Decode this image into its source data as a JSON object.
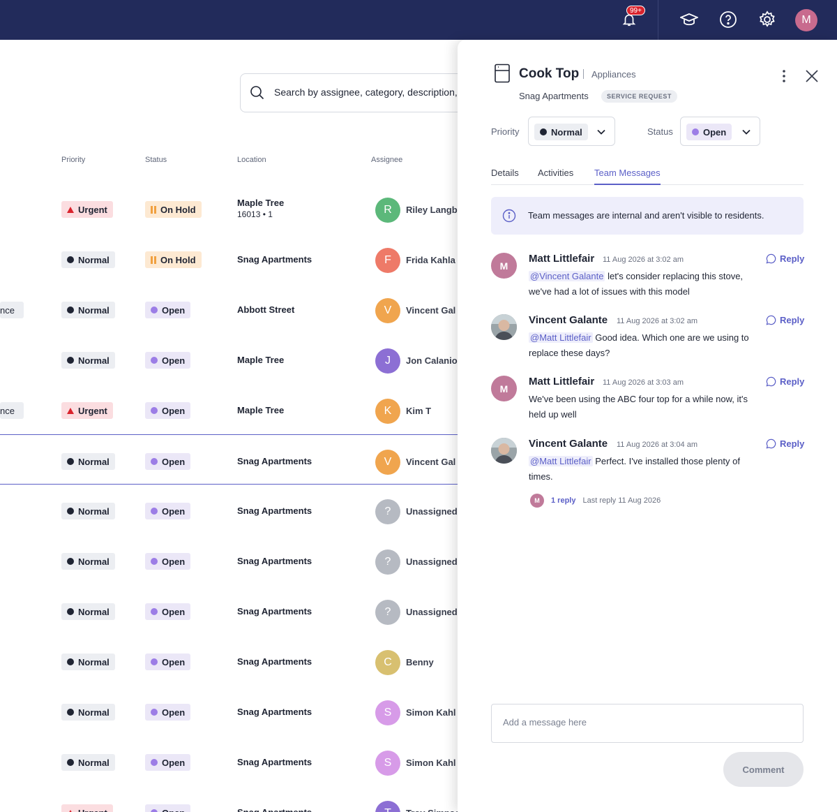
{
  "topbar": {
    "notif_badge": "99+",
    "avatar_initial": "M",
    "icons": [
      "bell-icon",
      "graduation-cap-icon",
      "help-icon",
      "gear-icon"
    ]
  },
  "search": {
    "placeholder": "Search by assignee, category, description,"
  },
  "table": {
    "columns": {
      "priority": "Priority",
      "status": "Status",
      "location": "Location",
      "assignee": "Assignee"
    },
    "rows": [
      {
        "cut": "",
        "priority": "Urgent",
        "status": "On Hold",
        "location": "Maple Tree",
        "location_sub": "16013 • 1",
        "initial": "R",
        "color": "#5cb87a",
        "assignee": "Riley Langbe"
      },
      {
        "cut": "",
        "priority": "Normal",
        "status": "On Hold",
        "location": "Snag Apartments",
        "location_sub": "",
        "initial": "F",
        "color": "#ee7a68",
        "assignee": "Frida Kahla"
      },
      {
        "cut": "nce",
        "priority": "Normal",
        "status": "Open",
        "location": "Abbott Street",
        "location_sub": "",
        "initial": "V",
        "color": "#f0a54e",
        "assignee": "Vincent Gal"
      },
      {
        "cut": "",
        "priority": "Normal",
        "status": "Open",
        "location": "Maple Tree",
        "location_sub": "",
        "initial": "J",
        "color": "#8c6fd4",
        "assignee": "Jon Calanio"
      },
      {
        "cut": "nce",
        "priority": "Urgent",
        "status": "Open",
        "location": "Maple Tree",
        "location_sub": "",
        "initial": "K",
        "color": "#f0a54e",
        "assignee": "Kim T"
      },
      {
        "cut": "",
        "priority": "Normal",
        "status": "Open",
        "location": "Snag Apartments",
        "location_sub": "",
        "initial": "V",
        "color": "#f0a54e",
        "assignee": "Vincent Gal"
      },
      {
        "cut": "",
        "priority": "Normal",
        "status": "Open",
        "location": "Snag Apartments",
        "location_sub": "",
        "initial": "?",
        "color": "#b6bac2",
        "assignee": "Unassigned"
      },
      {
        "cut": "",
        "priority": "Normal",
        "status": "Open",
        "location": "Snag Apartments",
        "location_sub": "",
        "initial": "?",
        "color": "#b6bac2",
        "assignee": "Unassigned"
      },
      {
        "cut": "",
        "priority": "Normal",
        "status": "Open",
        "location": "Snag Apartments",
        "location_sub": "",
        "initial": "?",
        "color": "#b6bac2",
        "assignee": "Unassigned"
      },
      {
        "cut": "",
        "priority": "Normal",
        "status": "Open",
        "location": "Snag Apartments",
        "location_sub": "",
        "initial": "C",
        "color": "#d8c070",
        "assignee": "Benny"
      },
      {
        "cut": "",
        "priority": "Normal",
        "status": "Open",
        "location": "Snag Apartments",
        "location_sub": "",
        "initial": "S",
        "color": "#d79be8",
        "assignee": "Simon Kahl"
      },
      {
        "cut": "",
        "priority": "Normal",
        "status": "Open",
        "location": "Snag Apartments",
        "location_sub": "",
        "initial": "S",
        "color": "#d79be8",
        "assignee": "Simon Kahl"
      },
      {
        "cut": "",
        "priority": "Urgent",
        "status": "Open",
        "location": "Snag Apartments",
        "location_sub": "",
        "initial": "T",
        "color": "#8c6fd4",
        "assignee": "Troy Simpson"
      }
    ]
  },
  "panel": {
    "title": "Cook Top",
    "category": "Appliances",
    "location": "Snag Apartments",
    "type_badge": "SERVICE REQUEST",
    "priority_label": "Priority",
    "priority_value": "Normal",
    "status_label": "Status",
    "status_value": "Open",
    "tabs": [
      "Details",
      "Activities",
      "Team Messages"
    ],
    "info_text": "Team messages are internal and aren't visible to residents.",
    "reply_label": "Reply",
    "messages": [
      {
        "author": "Matt Littlefair",
        "time": "11 Aug 2026 at 3:02 am",
        "initial": "M",
        "mention": "@Vincent Galante",
        "text": " let's consider replacing this stove, we've had a lot of issues with this model"
      },
      {
        "author": "Vincent Galante",
        "time": "11 Aug 2026 at 3:02 am",
        "initial": "",
        "mention": "@Matt Littlefair",
        "text": " Good idea. Which one are we using to replace these days?"
      },
      {
        "author": "Matt Littlefair",
        "time": "11 Aug 2026 at 3:03 am",
        "initial": "M",
        "mention": "",
        "text": "We've been using the ABC four top for a while now, it's held up well"
      },
      {
        "author": "Vincent Galante",
        "time": "11 Aug 2026 at 3:04 am",
        "initial": "",
        "mention": "@Matt Littlefair",
        "text": " Perfect. I've installed those plenty of times."
      }
    ],
    "thread": {
      "initial": "M",
      "count": "1 reply",
      "last": "Last reply 11 Aug 2026"
    },
    "composer_placeholder": "Add a message here",
    "comment_label": "Comment"
  }
}
